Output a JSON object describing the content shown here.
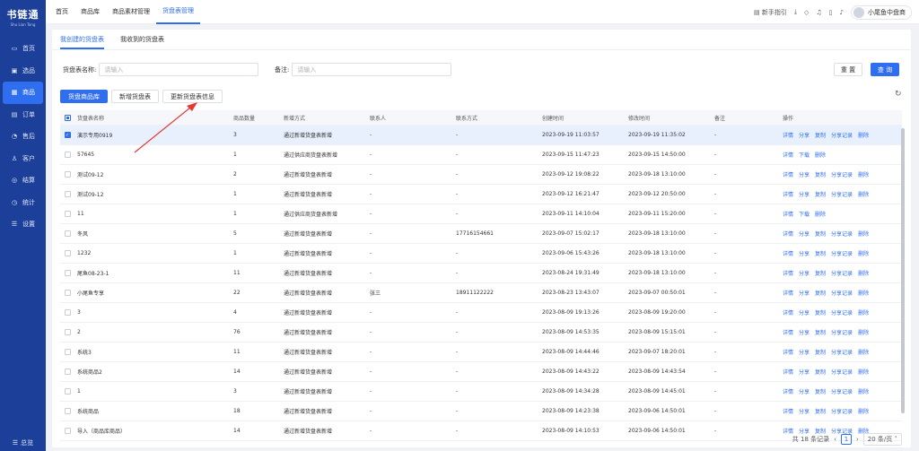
{
  "app": {
    "logo": "书链通",
    "logo_sub": "Shu Lian Tong"
  },
  "sidebar": {
    "items": [
      {
        "label": "首页",
        "icon": "monitor-icon"
      },
      {
        "label": "选品",
        "icon": "select-icon"
      },
      {
        "label": "商品",
        "icon": "goods-icon",
        "active": true
      },
      {
        "label": "订单",
        "icon": "order-icon"
      },
      {
        "label": "售后",
        "icon": "aftersale-icon"
      },
      {
        "label": "客户",
        "icon": "customer-icon"
      },
      {
        "label": "结算",
        "icon": "settle-icon"
      },
      {
        "label": "统计",
        "icon": "stats-icon"
      },
      {
        "label": "设置",
        "icon": "settings-icon"
      }
    ],
    "collapse_label": "总览"
  },
  "header": {
    "tabs": [
      "首页",
      "商品库",
      "商品素材管理",
      "货盘表管理"
    ],
    "active_tab": "货盘表管理",
    "guide_label": "新手指引",
    "user_name": "小尾鱼中盘商"
  },
  "subtabs": [
    "我创建的货盘表",
    "我收到的货盘表"
  ],
  "filters": {
    "name_label": "货盘表名称:",
    "name_placeholder": "请输入",
    "remark_label": "备注:",
    "remark_placeholder": "请输入",
    "reset_label": "重 置",
    "query_label": "查 询"
  },
  "toolbar": {
    "buttons": [
      "货盘商品库",
      "新增货盘表",
      "更新货盘表信息"
    ]
  },
  "table": {
    "columns": [
      "货盘表名称",
      "商品数量",
      "新增方式",
      "联系人",
      "联系方式",
      "创建时间",
      "修改时间",
      "备注",
      "操作"
    ],
    "rows": [
      {
        "name": "演示专用0919",
        "count": "3",
        "method": "通过新增货盘表新增",
        "contact": "-",
        "phone": "-",
        "created": "2023-09-19 11:03:57",
        "modified": "2023-09-19 11:35:02",
        "remark": "-",
        "ops": [
          "详情",
          "分享",
          "复制",
          "分享记录",
          "删除"
        ],
        "checked": true
      },
      {
        "name": "57645",
        "count": "1",
        "method": "通过供应商货盘表新增",
        "contact": "-",
        "phone": "-",
        "created": "2023-09-15 11:47:23",
        "modified": "2023-09-15 14:50:00",
        "remark": "-",
        "ops": [
          "详情",
          "下载",
          "删除"
        ]
      },
      {
        "name": "测试09-12",
        "count": "2",
        "method": "通过新增货盘表新增",
        "contact": "-",
        "phone": "-",
        "created": "2023-09-12 19:08:22",
        "modified": "2023-09-18 13:10:00",
        "remark": "-",
        "ops": [
          "详情",
          "分享",
          "复制",
          "分享记录",
          "删除"
        ]
      },
      {
        "name": "测试09-12",
        "count": "1",
        "method": "通过新增货盘表新增",
        "contact": "-",
        "phone": "-",
        "created": "2023-09-12 16:21:47",
        "modified": "2023-09-12 20:50:00",
        "remark": "-",
        "ops": [
          "详情",
          "分享",
          "复制",
          "分享记录",
          "删除"
        ]
      },
      {
        "name": "11",
        "count": "1",
        "method": "通过供应商货盘表新增",
        "contact": "-",
        "phone": "-",
        "created": "2023-09-11 14:10:04",
        "modified": "2023-09-11 15:20:00",
        "remark": "-",
        "ops": [
          "详情",
          "下载",
          "删除"
        ]
      },
      {
        "name": "冬风",
        "count": "5",
        "method": "通过新增货盘表新增",
        "contact": "-",
        "phone": "17716154661",
        "created": "2023-09-07 15:02:17",
        "modified": "2023-09-18 13:10:00",
        "remark": "-",
        "ops": [
          "详情",
          "分享",
          "复制",
          "分享记录",
          "删除"
        ]
      },
      {
        "name": "1232",
        "count": "1",
        "method": "通过新增货盘表新增",
        "contact": "-",
        "phone": "-",
        "created": "2023-09-06 15:43:26",
        "modified": "2023-09-18 13:10:00",
        "remark": "-",
        "ops": [
          "详情",
          "分享",
          "复制",
          "分享记录",
          "删除"
        ]
      },
      {
        "name": "尾鱼08-23-1",
        "count": "11",
        "method": "通过新增货盘表新增",
        "contact": "-",
        "phone": "-",
        "created": "2023-08-24 19:31:49",
        "modified": "2023-09-18 13:10:00",
        "remark": "-",
        "ops": [
          "详情",
          "分享",
          "复制",
          "分享记录",
          "删除"
        ]
      },
      {
        "name": "小尾鱼专享",
        "count": "22",
        "method": "通过新增货盘表新增",
        "contact": "张三",
        "phone": "18911122222",
        "created": "2023-08-23 13:43:07",
        "modified": "2023-09-07 00:50:01",
        "remark": "-",
        "ops": [
          "详情",
          "分享",
          "复制",
          "分享记录",
          "删除"
        ]
      },
      {
        "name": "3",
        "count": "4",
        "method": "通过新增货盘表新增",
        "contact": "-",
        "phone": "-",
        "created": "2023-08-09 19:13:26",
        "modified": "2023-08-09 19:20:00",
        "remark": "-",
        "ops": [
          "详情",
          "分享",
          "复制",
          "分享记录",
          "删除"
        ]
      },
      {
        "name": "2",
        "count": "76",
        "method": "通过新增货盘表新增",
        "contact": "-",
        "phone": "-",
        "created": "2023-08-09 14:53:35",
        "modified": "2023-08-09 15:15:01",
        "remark": "-",
        "ops": [
          "详情",
          "分享",
          "复制",
          "分享记录",
          "删除"
        ]
      },
      {
        "name": "系统3",
        "count": "11",
        "method": "通过新增货盘表新增",
        "contact": "-",
        "phone": "-",
        "created": "2023-08-09 14:44:46",
        "modified": "2023-09-07 18:20:01",
        "remark": "-",
        "ops": [
          "详情",
          "分享",
          "复制",
          "分享记录",
          "删除"
        ]
      },
      {
        "name": "系统商品2",
        "count": "14",
        "method": "通过新增货盘表新增",
        "contact": "-",
        "phone": "-",
        "created": "2023-08-09 14:43:22",
        "modified": "2023-08-09 14:43:54",
        "remark": "-",
        "ops": [
          "详情",
          "分享",
          "复制",
          "分享记录",
          "删除"
        ]
      },
      {
        "name": "1",
        "count": "3",
        "method": "通过新增货盘表新增",
        "contact": "-",
        "phone": "-",
        "created": "2023-08-09 14:34:28",
        "modified": "2023-08-09 14:45:01",
        "remark": "-",
        "ops": [
          "详情",
          "分享",
          "复制",
          "分享记录",
          "删除"
        ]
      },
      {
        "name": "系统商品",
        "count": "18",
        "method": "通过新增货盘表新增",
        "contact": "-",
        "phone": "-",
        "created": "2023-08-09 14:23:38",
        "modified": "2023-09-06 14:50:01",
        "remark": "-",
        "ops": [
          "详情",
          "分享",
          "复制",
          "分享记录",
          "删除"
        ]
      },
      {
        "name": "导入（商品库商品）",
        "count": "14",
        "method": "通过新增货盘表新增",
        "contact": "-",
        "phone": "-",
        "created": "2023-08-09 14:10:53",
        "modified": "2023-09-06 14:50:01",
        "remark": "-",
        "ops": [
          "详情",
          "分享",
          "复制",
          "分享记录",
          "删除"
        ]
      }
    ]
  },
  "pager": {
    "total_text": "共 18 条记录",
    "current_page": "1",
    "page_size": "20 条/页"
  },
  "colors": {
    "primary": "#2f6fef",
    "sidebar_bg": "#1c3f9a",
    "annotation_arrow": "#e53935"
  }
}
